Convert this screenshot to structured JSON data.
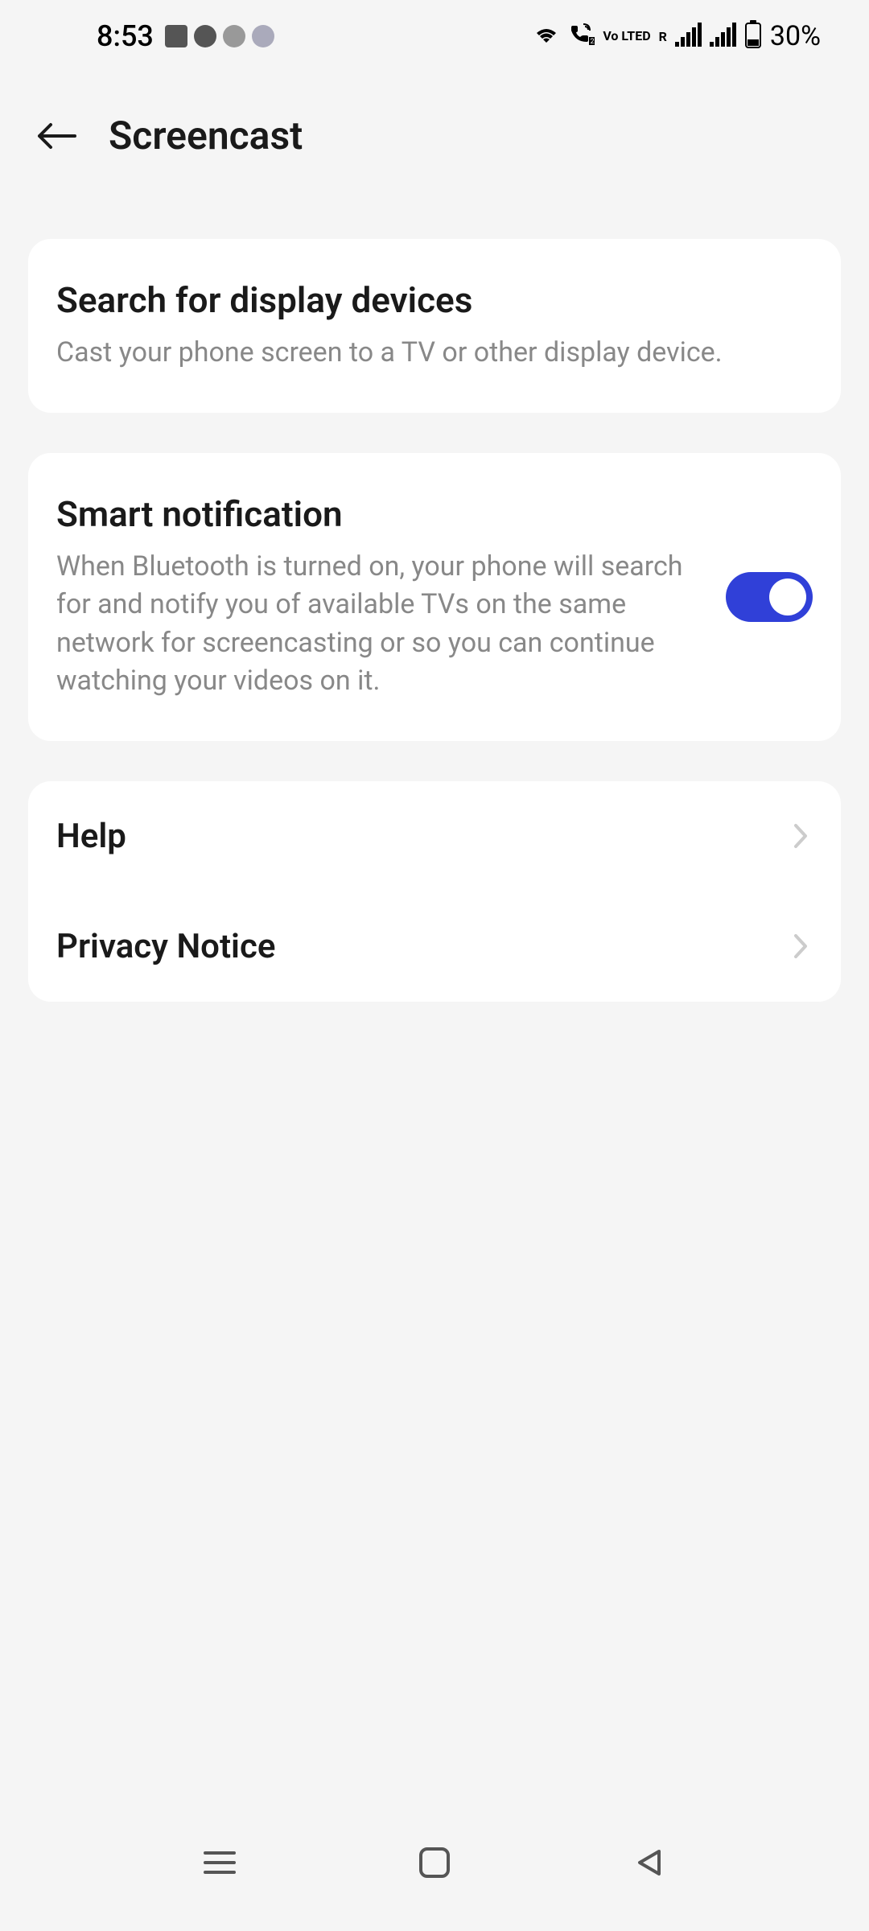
{
  "statusBar": {
    "time": "8:53",
    "battery": "30%",
    "volte": "Vo LTED",
    "r": "R"
  },
  "header": {
    "title": "Screencast"
  },
  "searchDevices": {
    "title": "Search for display devices",
    "desc": "Cast your phone screen to a TV or other display device."
  },
  "smartNotification": {
    "title": "Smart notification",
    "desc": "When Bluetooth is turned on, your phone will search for and notify you of available TVs on the same network for screencasting or so you can continue watching your videos on it.",
    "enabled": true
  },
  "links": {
    "help": "Help",
    "privacy": "Privacy Notice"
  }
}
